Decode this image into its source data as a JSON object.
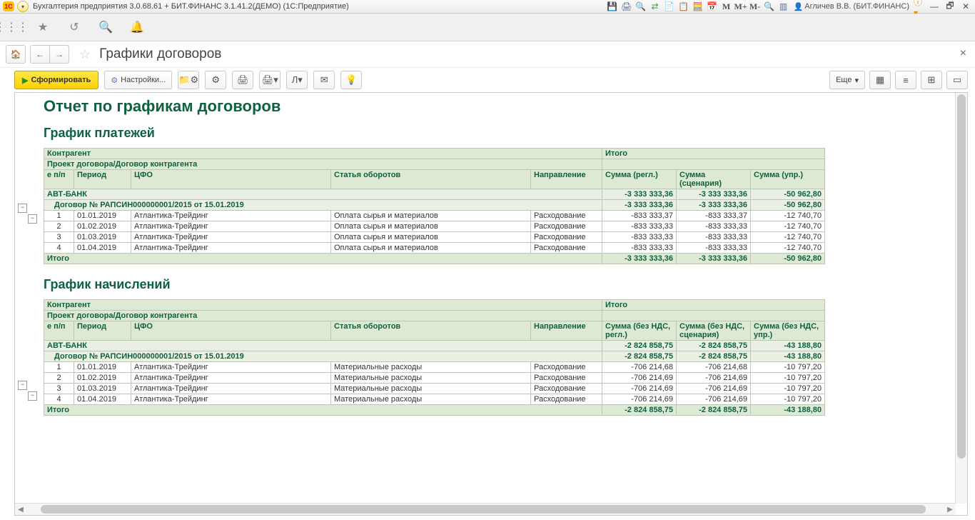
{
  "title_bar": {
    "app_title": "Бухгалтерия предприятия 3.0.68.61 + БИТ.ФИНАНС 3.1.41.2(ДЕМО)  (1С:Предприятие)",
    "user": "Агличев В.В. (БИТ.ФИНАНС)"
  },
  "icons": {
    "m": "M",
    "m_plus": "M+",
    "m_minus": "M-"
  },
  "page": {
    "title": "Графики договоров"
  },
  "toolbar": {
    "run": "Сформировать",
    "settings": "Настройки...",
    "more": "Еще"
  },
  "report": {
    "title": "Отчет по графикам договоров",
    "section1": {
      "title": "График платежей",
      "hdr_contr": "Контрагент",
      "hdr_itogo": "Итого",
      "hdr_proj": "Проект договора/Договор контрагента",
      "col_np": "е п/п",
      "col_period": "Период",
      "col_cfo": "ЦФО",
      "col_stat": "Статья оборотов",
      "col_dir": "Направление",
      "col_s1": "Сумма (регл.)",
      "col_s2": "Сумма (сценария)",
      "col_s3": "Сумма (упр.)",
      "group": "АВТ-БАНК",
      "group_s1": "-3 333 333,36",
      "group_s2": "-3 333 333,36",
      "group_s3": "-50 962,80",
      "contract": "Договор № РАПСИН000000001/2015 от 15.01.2019",
      "contract_s1": "-3 333 333,36",
      "contract_s2": "-3 333 333,36",
      "contract_s3": "-50 962,80",
      "rows": [
        {
          "n": "1",
          "per": "01.01.2019",
          "cfo": "Атлантика-Трейдинг",
          "stat": "Оплата сырья и материалов",
          "dir": "Расходование",
          "s1": "-833 333,37",
          "s2": "-833 333,37",
          "s3": "-12 740,70"
        },
        {
          "n": "2",
          "per": "01.02.2019",
          "cfo": "Атлантика-Трейдинг",
          "stat": "Оплата сырья и материалов",
          "dir": "Расходование",
          "s1": "-833 333,33",
          "s2": "-833 333,33",
          "s3": "-12 740,70"
        },
        {
          "n": "3",
          "per": "01.03.2019",
          "cfo": "Атлантика-Трейдинг",
          "stat": "Оплата сырья и материалов",
          "dir": "Расходование",
          "s1": "-833 333,33",
          "s2": "-833 333,33",
          "s3": "-12 740,70"
        },
        {
          "n": "4",
          "per": "01.04.2019",
          "cfo": "Атлантика-Трейдинг",
          "stat": "Оплата сырья и материалов",
          "dir": "Расходование",
          "s1": "-833 333,33",
          "s2": "-833 333,33",
          "s3": "-12 740,70"
        }
      ],
      "total_label": "Итого",
      "total_s1": "-3 333 333,36",
      "total_s2": "-3 333 333,36",
      "total_s3": "-50 962,80"
    },
    "section2": {
      "title": "График начислений",
      "hdr_contr": "Контрагент",
      "hdr_itogo": "Итого",
      "hdr_proj": "Проект договора/Договор контрагента",
      "col_np": "е п/п",
      "col_period": "Период",
      "col_cfo": "ЦФО",
      "col_stat": "Статья оборотов",
      "col_dir": "Направление",
      "col_s1": "Сумма (без НДС, регл.)",
      "col_s2": "Сумма (без НДС, сценария)",
      "col_s3": "Сумма (без НДС, упр.)",
      "group": "АВТ-БАНК",
      "group_s1": "-2 824 858,75",
      "group_s2": "-2 824 858,75",
      "group_s3": "-43 188,80",
      "contract": "Договор № РАПСИН000000001/2015 от 15.01.2019",
      "contract_s1": "-2 824 858,75",
      "contract_s2": "-2 824 858,75",
      "contract_s3": "-43 188,80",
      "rows": [
        {
          "n": "1",
          "per": "01.01.2019",
          "cfo": "Атлантика-Трейдинг",
          "stat": "Материальные расходы",
          "dir": "Расходование",
          "s1": "-706 214,68",
          "s2": "-706 214,68",
          "s3": "-10 797,20"
        },
        {
          "n": "2",
          "per": "01.02.2019",
          "cfo": "Атлантика-Трейдинг",
          "stat": "Материальные расходы",
          "dir": "Расходование",
          "s1": "-706 214,69",
          "s2": "-706 214,69",
          "s3": "-10 797,20"
        },
        {
          "n": "3",
          "per": "01.03.2019",
          "cfo": "Атлантика-Трейдинг",
          "stat": "Материальные расходы",
          "dir": "Расходование",
          "s1": "-706 214,69",
          "s2": "-706 214,69",
          "s3": "-10 797,20"
        },
        {
          "n": "4",
          "per": "01.04.2019",
          "cfo": "Атлантика-Трейдинг",
          "stat": "Материальные расходы",
          "dir": "Расходование",
          "s1": "-706 214,69",
          "s2": "-706 214,69",
          "s3": "-10 797,20"
        }
      ],
      "total_label": "Итого",
      "total_s1": "-2 824 858,75",
      "total_s2": "-2 824 858,75",
      "total_s3": "-43 188,80"
    }
  }
}
